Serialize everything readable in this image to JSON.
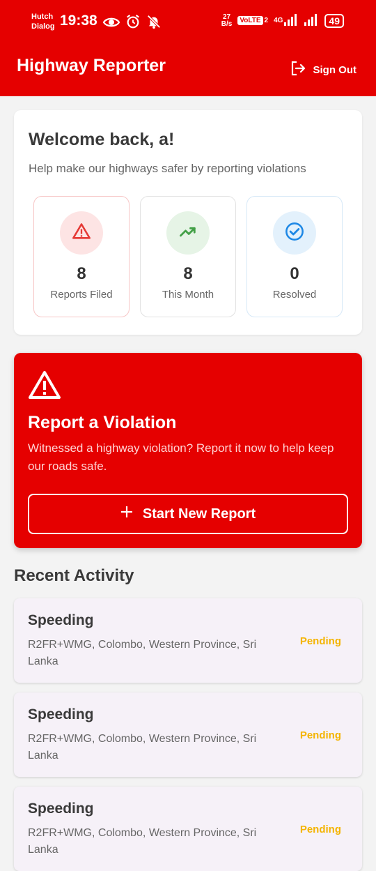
{
  "status_bar": {
    "carrier_line1": "Hutch",
    "carrier_line2": "Dialog",
    "time": "19:38",
    "net_speed_value": "27",
    "net_speed_unit": "B/s",
    "volte": "VoLTE",
    "sim_slot": "2",
    "network": "4G",
    "battery": "49",
    "icons": [
      "eye-icon",
      "alarm-icon",
      "bell-off-icon",
      "signal-icon",
      "signal-icon"
    ]
  },
  "appbar": {
    "title": "Highway Reporter",
    "signout_label": "Sign Out"
  },
  "welcome": {
    "title": "Welcome back, a!",
    "subtitle": "Help make our highways safer by reporting violations",
    "stats": [
      {
        "value": "8",
        "label": "Reports Filed",
        "icon": "warning-icon",
        "color": "#e53935",
        "bg": "#fde4e4",
        "border": "#f7c6c6"
      },
      {
        "value": "8",
        "label": "This Month",
        "icon": "trending-up-icon",
        "color": "#43a047",
        "bg": "#e6f4e6",
        "border": "#e2e2e2"
      },
      {
        "value": "0",
        "label": "Resolved",
        "icon": "check-circle-icon",
        "color": "#1e88e5",
        "bg": "#e3f1fc",
        "border": "#d6e8f7"
      }
    ]
  },
  "report": {
    "title": "Report a Violation",
    "description": "Witnessed a highway violation? Report it now to help keep our roads safe.",
    "button_label": "Start New Report"
  },
  "recent": {
    "title": "Recent Activity",
    "items": [
      {
        "type": "Speeding",
        "location": "R2FR+WMG, Colombo, Western Province, Sri Lanka",
        "status": "Pending"
      },
      {
        "type": "Speeding",
        "location": "R2FR+WMG, Colombo, Western Province, Sri Lanka",
        "status": "Pending"
      },
      {
        "type": "Speeding",
        "location": "R2FR+WMG, Colombo, Western Province, Sri Lanka",
        "status": "Pending"
      }
    ]
  },
  "colors": {
    "brand": "#e50000",
    "pending": "#f4b400",
    "background": "#f3f3f3"
  }
}
